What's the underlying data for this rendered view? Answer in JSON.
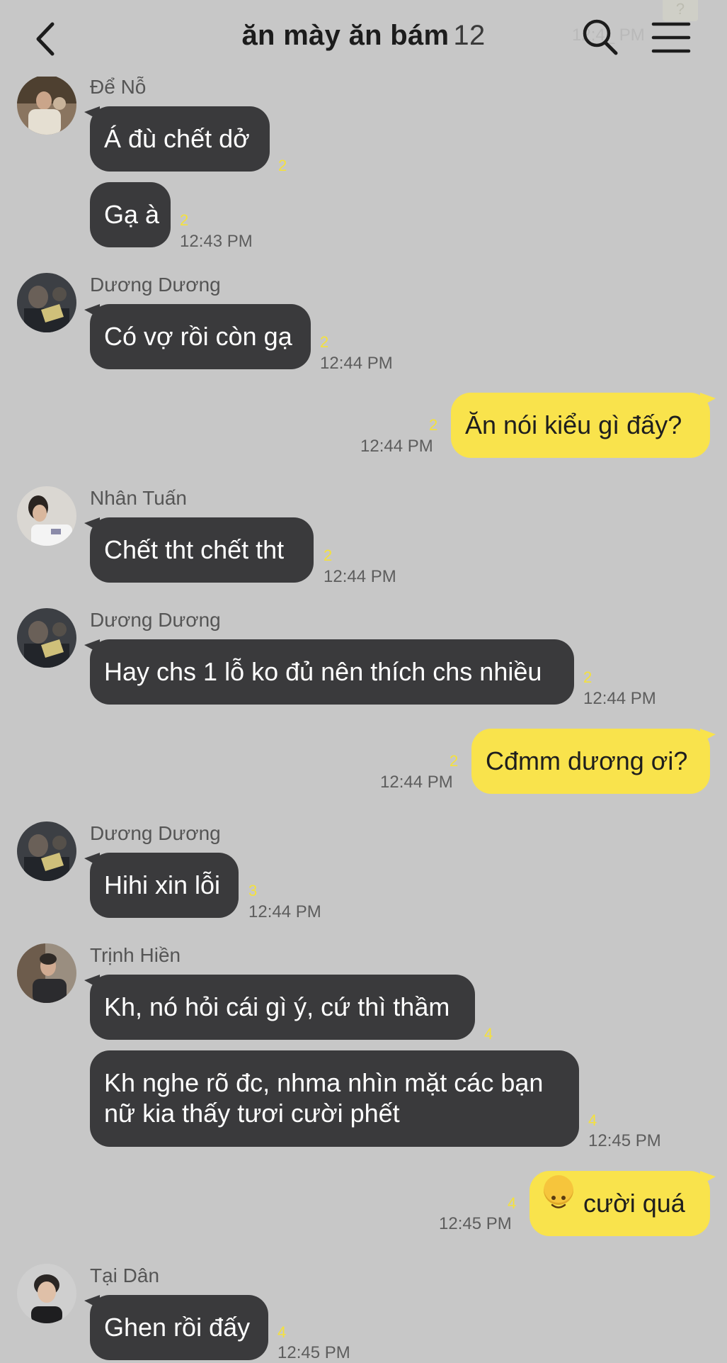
{
  "header": {
    "title": "ăn mày ăn bám",
    "member_count": "12",
    "ghost_time": "12:4_ PM",
    "ghost_box": "?"
  },
  "colors": {
    "background": "#c7c7c7",
    "incoming_bubble": "#3a3a3c",
    "outgoing_bubble": "#f9e34c",
    "unread_count": "#f4e13d"
  },
  "messages": [
    {
      "sender": "Để Nỗ",
      "text": "Á đù chết dở",
      "unread": "2",
      "time": ""
    },
    {
      "sender": "",
      "text": "Gạ à",
      "unread": "2",
      "time": "12:43 PM"
    },
    {
      "sender": "Dương Dương",
      "text": "Có vợ rồi còn gạ",
      "unread": "2",
      "time": "12:44 PM"
    },
    {
      "sender": "me",
      "text": "Ăn nói kiểu gì đấy?",
      "unread": "2",
      "time": "12:44 PM"
    },
    {
      "sender": "Nhân Tuấn",
      "text": "Chết tht chết tht",
      "unread": "2",
      "time": "12:44 PM"
    },
    {
      "sender": "Dương Dương",
      "text": "Hay chs 1 lỗ ko đủ nên thích chs nhiều",
      "unread": "2",
      "time": "12:44 PM"
    },
    {
      "sender": "me",
      "text": "Cđmm dương ơi?",
      "unread": "2",
      "time": "12:44 PM"
    },
    {
      "sender": "Dương Dương",
      "text": "Hihi xin lỗi",
      "unread": "3",
      "time": "12:44 PM"
    },
    {
      "sender": "Trịnh Hiền",
      "text": "Kh, nó hỏi cái gì ý, cứ thì thầm",
      "unread": "4",
      "time": ""
    },
    {
      "sender": "",
      "text": "Kh nghe rõ đc, nhma nhìn mặt các bạn nữ kia thấy tươi cười phết",
      "unread": "4",
      "time": "12:45 PM"
    },
    {
      "sender": "me",
      "text": "cười quá",
      "emoji": "slightly-smiling-face",
      "unread": "4",
      "time": "12:45 PM"
    },
    {
      "sender": "Tại Dân",
      "text": "Ghen rồi đấy",
      "unread": "4",
      "time": "12:45 PM"
    }
  ]
}
